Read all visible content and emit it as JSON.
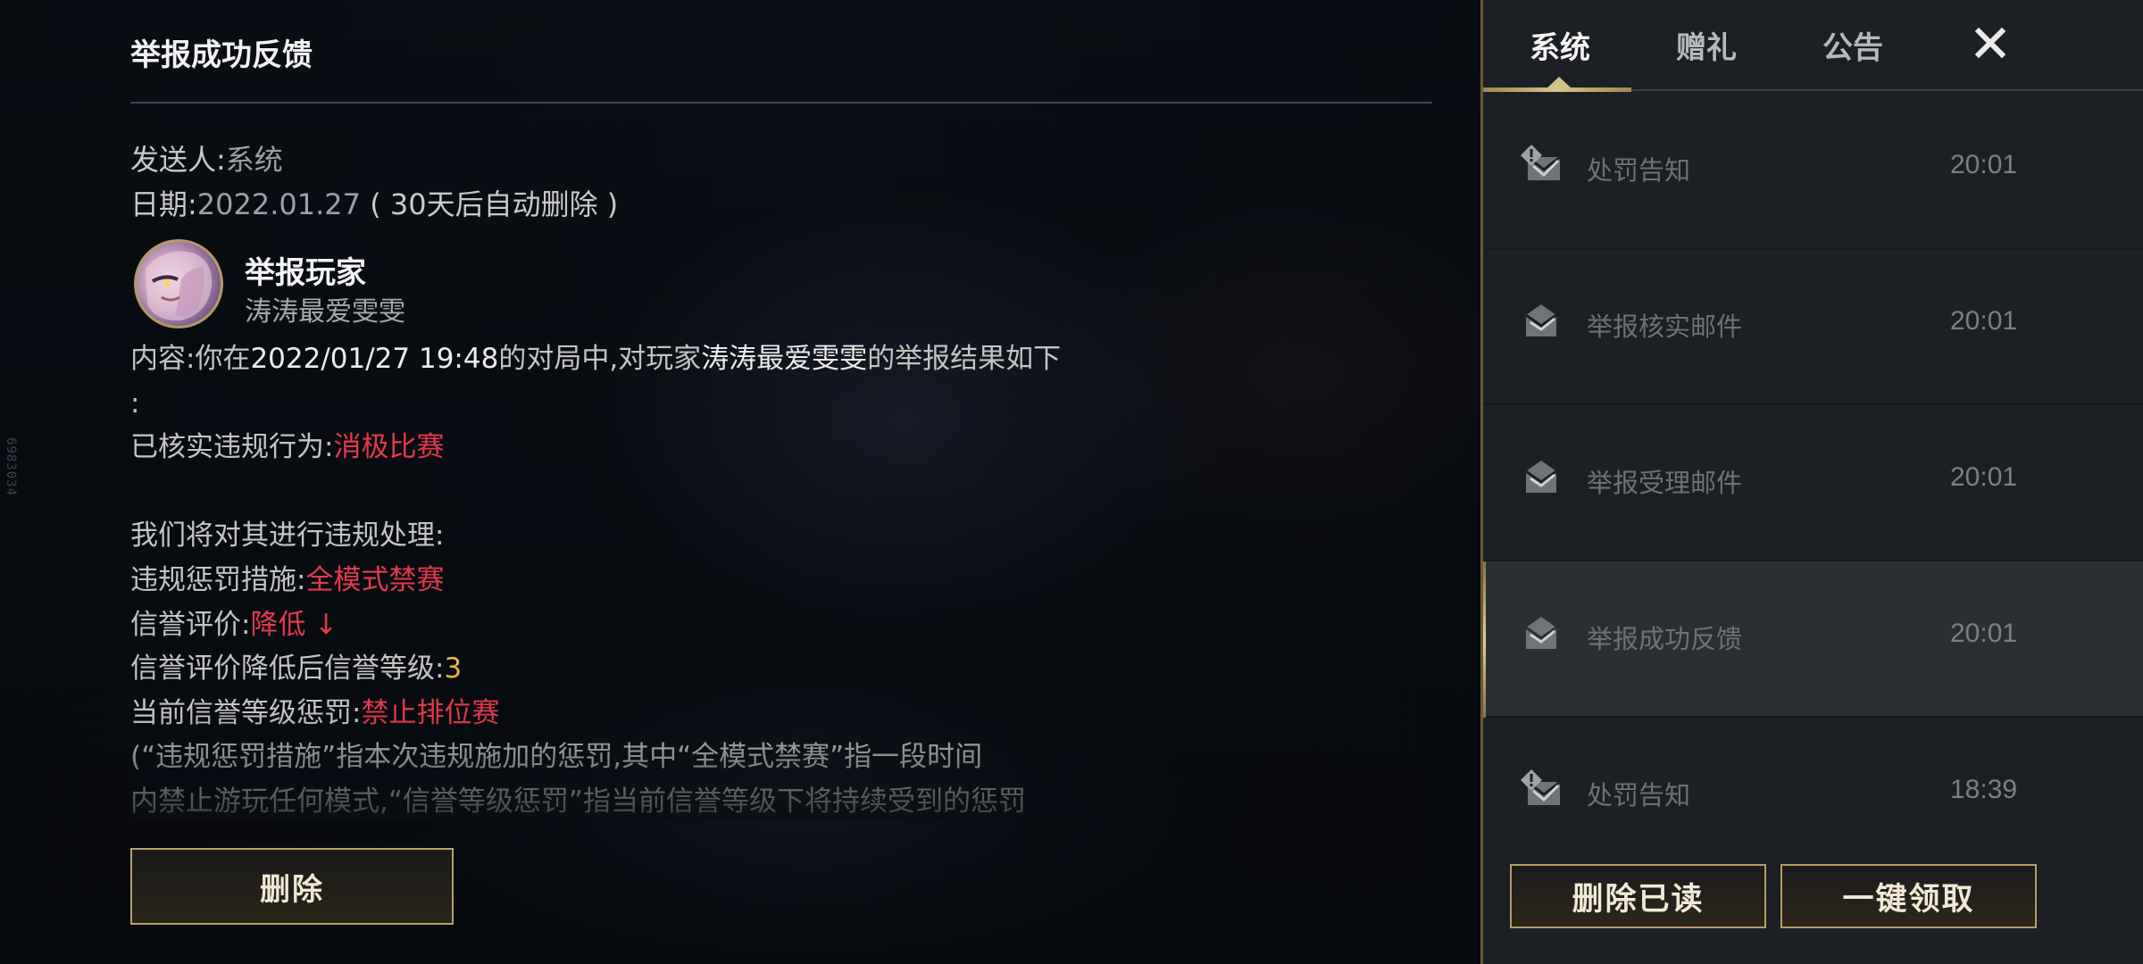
{
  "colors": {
    "accent_gold": "#b59c66",
    "highlight_red": "#e23a4a",
    "highlight_gold": "#e8b43c",
    "panel_bg": "#1c1f24"
  },
  "side_id": "6983034",
  "detail": {
    "title": "举报成功反馈",
    "sender_label": "发送人:",
    "sender_value": "系统",
    "date_label": "日期:",
    "date_value": "2022.01.27",
    "date_note": "( 30天后自动删除 )",
    "reported_title": "举报玩家",
    "reported_name": "涛涛最爱雯雯",
    "content": {
      "prefix": "内容:你在",
      "match_time": "2022/01/27 19:48",
      "mid": "的对局中,对玩家",
      "player": "涛涛最爱雯雯",
      "suffix": "的举报结果如下",
      "colon": ":"
    },
    "verified_label": "已核实违规行为:",
    "verified_value": "消极比赛",
    "process_intro": "我们将对其进行违规处理:",
    "penalty_label": "违规惩罚措施:",
    "penalty_value": "全模式禁赛",
    "credit_label": "信誉评价:",
    "credit_value": "降低 ↓",
    "credit_level_label": "信誉评价降低后信誉等级:",
    "credit_level_value": "3",
    "current_penalty_label": "当前信誉等级惩罚:",
    "current_penalty_value": "禁止排位赛",
    "note_line1": "(“违规惩罚措施”指本次违规施加的惩罚,其中“全模式禁赛”指一段时间",
    "note_line2": "内禁止游玩任何模式,“信誉等级惩罚”指当前信誉等级下将持续受到的惩罚",
    "delete_button": "删除"
  },
  "panel": {
    "tabs": [
      {
        "label": "系统",
        "active": true
      },
      {
        "label": "赠礼",
        "active": false
      },
      {
        "label": "公告",
        "active": false
      }
    ],
    "close_icon": "close-icon",
    "mails": [
      {
        "subject": "处罚告知",
        "time": "20:01",
        "icon": "mail-alert-icon",
        "selected": false
      },
      {
        "subject": "举报核实邮件",
        "time": "20:01",
        "icon": "mail-read-icon",
        "selected": false
      },
      {
        "subject": "举报受理邮件",
        "time": "20:01",
        "icon": "mail-read-icon",
        "selected": false
      },
      {
        "subject": "举报成功反馈",
        "time": "20:01",
        "icon": "mail-read-icon",
        "selected": true
      },
      {
        "subject": "处罚告知",
        "time": "18:39",
        "icon": "mail-alert-icon",
        "selected": false
      }
    ],
    "delete_read_button": "删除已读",
    "claim_all_button": "一键领取"
  }
}
